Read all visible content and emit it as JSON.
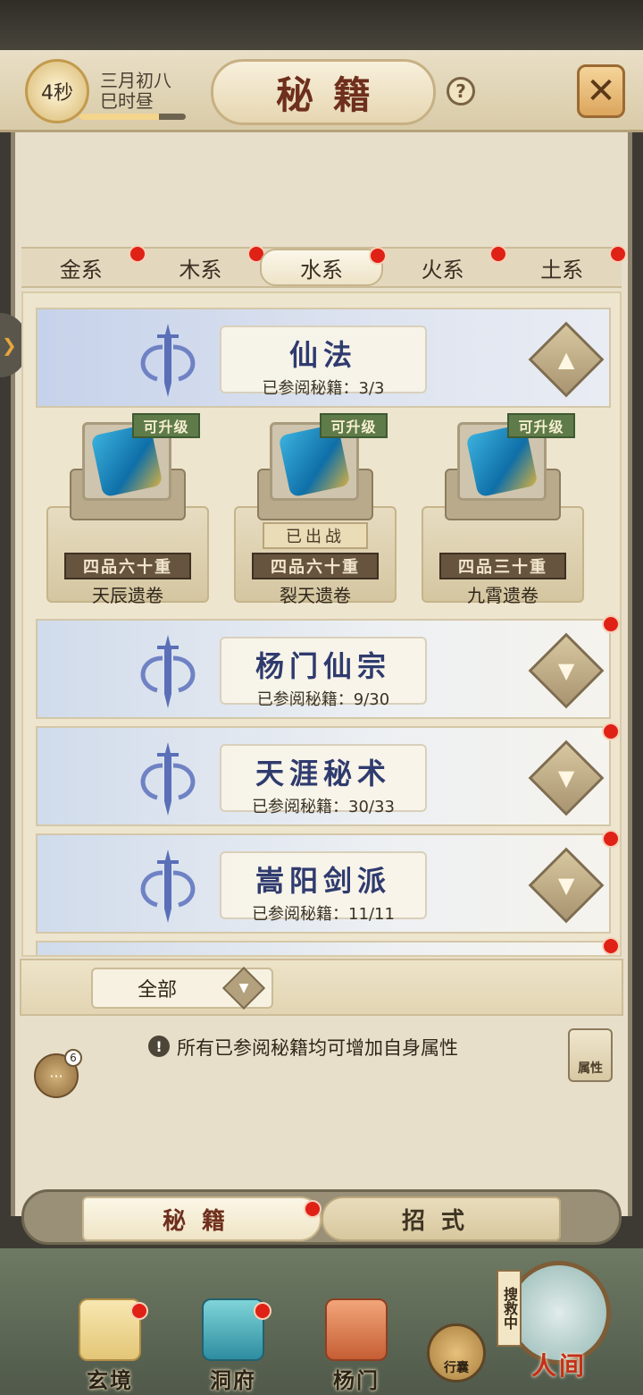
{
  "header": {
    "timer": "4秒",
    "date_line1": "三月初八",
    "date_line2": "巳时昼",
    "time_progress": 0.75,
    "title": "秘籍",
    "help": "?"
  },
  "tabs": [
    {
      "label": "金系",
      "has_dot": true
    },
    {
      "label": "木系",
      "has_dot": true
    },
    {
      "label": "水系",
      "has_dot": true,
      "active": true
    },
    {
      "label": "火系",
      "has_dot": true
    },
    {
      "label": "土系",
      "has_dot": true
    }
  ],
  "categories": [
    {
      "name": "仙法",
      "progress_label": "已参阅秘籍：3/3",
      "expanded": true
    },
    {
      "name": "杨门仙宗",
      "progress_label": "已参阅秘籍：9/30"
    },
    {
      "name": "天涯秘术",
      "progress_label": "已参阅秘籍：30/33"
    },
    {
      "name": "嵩阳剑派",
      "progress_label": "已参阅秘籍：11/11"
    }
  ],
  "books": [
    {
      "upgrade": "可升级",
      "grade": "四品六十重",
      "name": "天辰遗卷"
    },
    {
      "upgrade": "可升级",
      "status": "已出战",
      "grade": "四品六十重",
      "name": "裂天遗卷"
    },
    {
      "upgrade": "可升级",
      "grade": "四品三十重",
      "name": "九霄遗卷"
    }
  ],
  "filter": {
    "selected": "全部"
  },
  "info_text": "所有已参阅秘籍均可增加自身属性",
  "chat_badge": "6",
  "attr_button": "属性",
  "switch": {
    "left": "秘籍",
    "right": "招式"
  },
  "nav": [
    {
      "label": "玄境",
      "has_dot": true
    },
    {
      "label": "洞府",
      "has_dot": true
    },
    {
      "label": "杨门",
      "has_dot": false
    },
    {
      "label": "行囊"
    },
    {
      "label": "人间",
      "tag": "搜救中"
    }
  ]
}
